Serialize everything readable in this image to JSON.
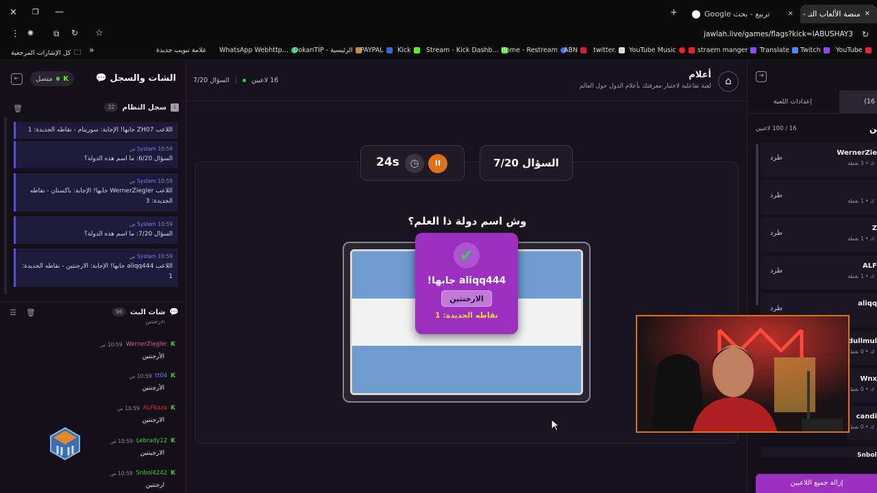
{
  "browser": {
    "tabs": [
      {
        "title": "منصة الألعاب التـ - Jawla"
      },
      {
        "title": "تربيع - بحث Google"
      }
    ],
    "url": "jawlah.live/games/flags?kick=IABUSHAY3",
    "bookmarks": [
      "YouTube",
      "Twitch",
      "Translate",
      "straem manger",
      "YouTube Music",
      "twitter.",
      "ABN",
      "Home - Restream",
      "Stream - Kick Dashb...",
      "Kick",
      "PAYPAL",
      "DokanTIP - الرئيسية",
      "WhatsApp Webhttp...",
      "علامة تبويب جديدة"
    ],
    "all_bookmarks": "كل الإشارات المرجعية",
    "more": "»"
  },
  "left": {
    "title": "الشات والسجل",
    "status": "متصل",
    "log_title": "سجل النظام",
    "log_count": "32",
    "log_first": "اللاعب ZH07 جابها! الإجابة: سورينام - نقاطه الجديدة: 1",
    "log": [
      {
        "sender": "System",
        "time": "10:59 ص",
        "text": "السؤال 6/20: ما اسم هذه الدولة؟"
      },
      {
        "sender": "System",
        "time": "10:59 ص",
        "text": "اللاعب WernerZiegler جابها! الإجابة: باكستان - نقاطه الجديدة: 3"
      },
      {
        "sender": "System",
        "time": "10:59 ص",
        "text": "السؤال 7/20: ما اسم هذه الدولة؟"
      },
      {
        "sender": "System",
        "time": "10:59 ص",
        "text": "اللاعب aliqq444 جابها! الإجابة: الارجنتين - نقاطه الجديدة: 1"
      }
    ],
    "chat_title": "شات البث",
    "chat_count": "96",
    "chat_partial": "الأرجنتين",
    "chat": [
      {
        "user": "WernerZiegler",
        "color": "#e0559a",
        "time": "10:59 ص",
        "text": "الأرجنتين"
      },
      {
        "user": "tt04",
        "color": "#4a8cff",
        "time": "10:59 ص",
        "text": "الأرجنتين"
      },
      {
        "user": "ALFkaza",
        "color": "#e02a2a",
        "time": "10:59 ص",
        "text": "الارجنتين"
      },
      {
        "user": "Lebrady12",
        "color": "#3ccf3c",
        "time": "10:59 ص",
        "text": "الارجينتين"
      },
      {
        "user": "Snbol4242",
        "color": "#3ccf3c",
        "time": "10:59 ص",
        "text": "ارجنتين"
      }
    ]
  },
  "game": {
    "title": "أعلام",
    "subtitle": "لعبة تفاعلية لاختبار معرفتك بأعلام الدول حول العالم",
    "players": "16 لاعبين",
    "question_short": "السؤال 7/20",
    "question_card": "السؤال 7/20",
    "timer": "24s",
    "prompt": "وش اسم دولة ذا العلم؟",
    "popup": {
      "winner": "aliqq444 جابها!",
      "answer": "الارجنتين",
      "points": "نقاطه الجديدة: 1"
    }
  },
  "right": {
    "tab_players": "(16",
    "tab_settings": "إعدادات اللعبة",
    "heading": "ين",
    "count": "16 / 100 لاعبين",
    "kick_label": "طرد",
    "players": [
      {
        "name": "WernerZie",
        "points": "ك • 3 نقطة"
      },
      {
        "name": "",
        "points": "ك • 1 نقطة"
      },
      {
        "name": "Z",
        "points": "ك • 1 نقطة"
      },
      {
        "name": "ALF",
        "points": "ك • 1 نقطة"
      },
      {
        "name": "aliqq",
        "points": ""
      }
    ],
    "partial_players": [
      {
        "name": "dullmul",
        "points": "ك • 0 نقط"
      },
      {
        "name": "Wnx",
        "points": "ك • 0 نقط"
      },
      {
        "name": "candi",
        "points": "ك • 0 نقط"
      },
      {
        "name": "Snbol",
        "points": ""
      }
    ],
    "remove_all": "إزالة جميع اللاعبين"
  },
  "colors": {
    "accent": "#9b2fc0",
    "kick_green": "#53fc18",
    "system_blue": "#4b55d8"
  }
}
